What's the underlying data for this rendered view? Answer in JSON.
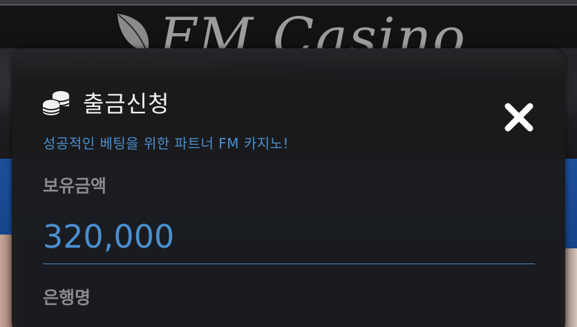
{
  "background": {
    "logo_text": "FM Casino"
  },
  "modal": {
    "title": "출금신청",
    "title_icon": "coins-icon",
    "close_icon": "close-icon",
    "subtitle": "성공적인 베팅을 위한 파트너 FM 카지노!",
    "balance_label": "보유금액",
    "balance_value": "320,000",
    "bank_label": "은행명"
  },
  "colors": {
    "accent": "#4a8fcf",
    "modal_bg": "#1a1a1c",
    "label": "#8a8a8a",
    "title": "#f2f2f2"
  }
}
